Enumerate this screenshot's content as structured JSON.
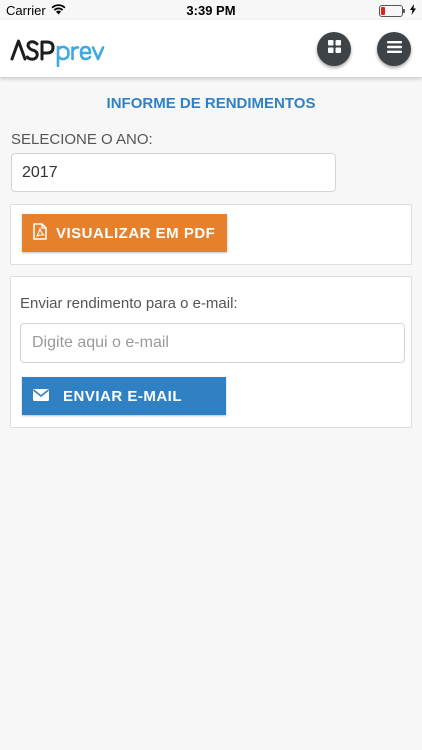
{
  "status_bar": {
    "carrier": "Carrier",
    "time": "3:39 PM"
  },
  "header": {
    "logo_text": "ASPPREV",
    "logo_colors": {
      "dark": "#1d1d1b",
      "accent": "#3fa9e0"
    }
  },
  "page": {
    "title": "INFORME DE RENDIMENTOS",
    "year_label": "SELECIONE O ANO:",
    "year_value": "2017"
  },
  "pdf_panel": {
    "button_label": "VISUALIZAR EM PDF",
    "icon": "pdf-file-icon",
    "color": "#e7802b"
  },
  "email_panel": {
    "label": "Enviar rendimento para o e-mail:",
    "input_placeholder": "Digite aqui o e-mail",
    "input_value": "",
    "button_label": "ENVIAR E-MAIL",
    "icon": "envelope-icon",
    "color": "#2f81c4"
  }
}
